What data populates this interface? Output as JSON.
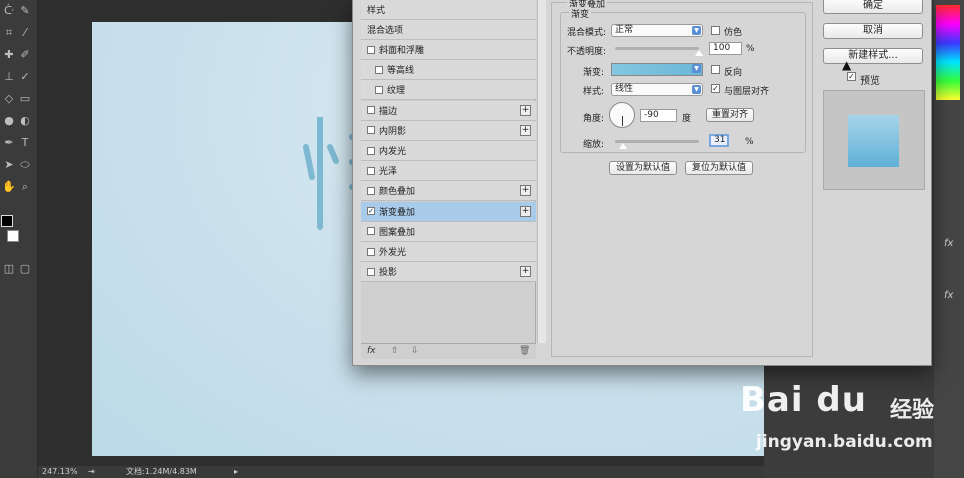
{
  "dialog": {
    "styles_header": "样式",
    "blend_options": "混合选项",
    "style_items": [
      {
        "label": "斜面和浮雕",
        "checked": false,
        "has_plus": false,
        "indent": false
      },
      {
        "label": "等高线",
        "checked": false,
        "has_plus": false,
        "indent": true
      },
      {
        "label": "纹理",
        "checked": false,
        "has_plus": false,
        "indent": true
      },
      {
        "label": "描边",
        "checked": false,
        "has_plus": true,
        "indent": false
      },
      {
        "label": "内阴影",
        "checked": false,
        "has_plus": true,
        "indent": false
      },
      {
        "label": "内发光",
        "checked": false,
        "has_plus": false,
        "indent": false
      },
      {
        "label": "光泽",
        "checked": false,
        "has_plus": false,
        "indent": false
      },
      {
        "label": "颜色叠加",
        "checked": false,
        "has_plus": true,
        "indent": false
      },
      {
        "label": "渐变叠加",
        "checked": true,
        "has_plus": true,
        "indent": false,
        "selected": true
      },
      {
        "label": "图案叠加",
        "checked": false,
        "has_plus": false,
        "indent": false
      },
      {
        "label": "外发光",
        "checked": false,
        "has_plus": false,
        "indent": false
      },
      {
        "label": "投影",
        "checked": false,
        "has_plus": true,
        "indent": false
      }
    ],
    "footer": {
      "fx": "fx",
      "up": "⇧",
      "down": "⇩",
      "trash": "🗑"
    },
    "section_title": "渐变叠加",
    "group_title": "渐变",
    "blend_mode_label": "混合模式:",
    "blend_mode_value": "正常",
    "dither_label": "仿色",
    "opacity_label": "不透明度:",
    "opacity_value": "100",
    "opacity_unit": "%",
    "opacity_level": 1.0,
    "gradient_label": "渐变:",
    "reverse_label": "反向",
    "style_label": "样式:",
    "style_value": "线性",
    "align_layer_label": "与图层对齐",
    "align_layer_checked": true,
    "angle_label": "角度:",
    "angle_value": "-90",
    "angle_unit": "度",
    "reset_align_label": "重置对齐",
    "scale_label": "缩放:",
    "scale_value": "31",
    "scale_unit": "%",
    "scale_level": 0.1,
    "set_default_label": "设置为默认值",
    "reset_default_label": "复位为默认值",
    "ok_label": "确定",
    "cancel_label": "取消",
    "new_style_label": "新建样式...",
    "preview_label": "预览",
    "preview_checked": true
  },
  "statusbar": {
    "zoom": "247.13%",
    "doc": "文档:1.24M/4.83M"
  },
  "watermark": {
    "logo": "Bai du",
    "text": "经验",
    "url": "jingyan.baidu.com"
  },
  "colors": {
    "accent": "#a9cbea",
    "gradient_start": "#84c7e0",
    "gradient_end": "#6ab7d8",
    "canvas_text": "#7fb8d2"
  }
}
